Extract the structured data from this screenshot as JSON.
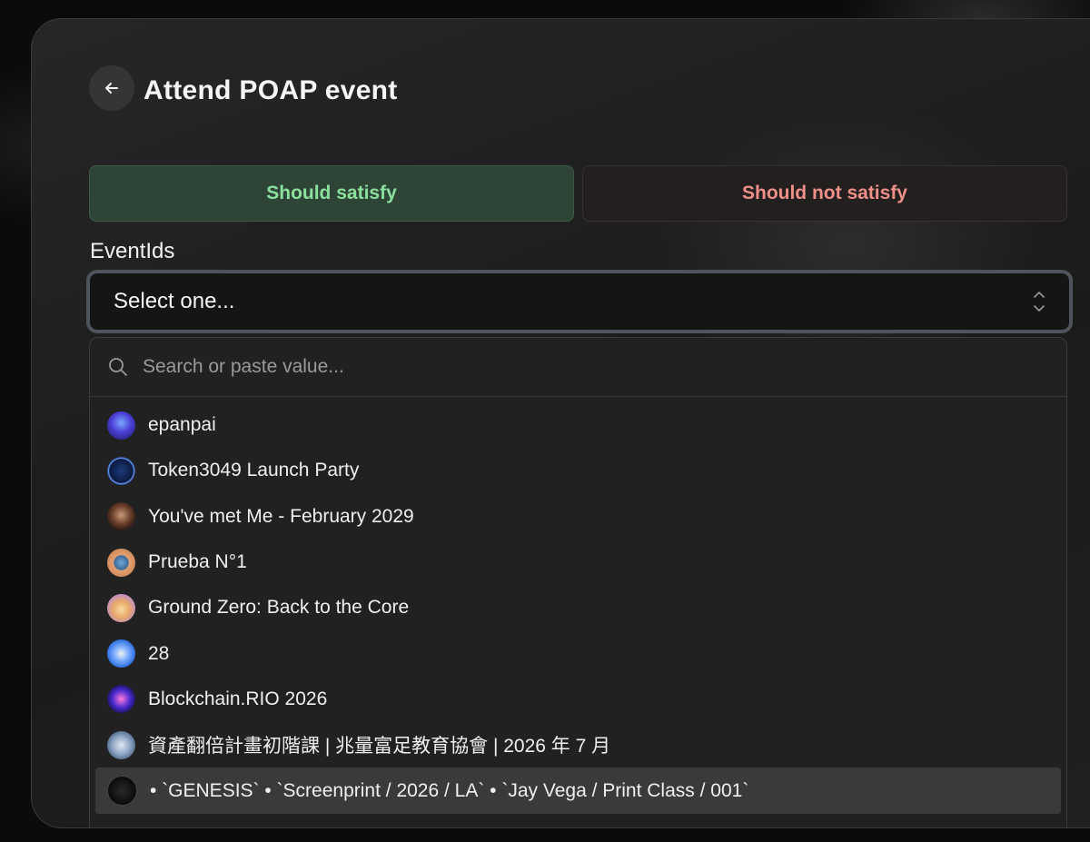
{
  "header": {
    "title": "Attend POAP event"
  },
  "toggles": {
    "should_satisfy": "Should satisfy",
    "should_not_satisfy": "Should not satisfy"
  },
  "field": {
    "label": "EventIds",
    "select_placeholder": "Select one..."
  },
  "search": {
    "placeholder": "Search or paste value..."
  },
  "options": [
    {
      "label": "epanpai",
      "icon": "event-avatar"
    },
    {
      "label": "Token3049 Launch Party",
      "icon": "event-avatar"
    },
    {
      "label": "You've met Me - February 2029",
      "icon": "event-avatar"
    },
    {
      "label": "Prueba N°1",
      "icon": "event-avatar"
    },
    {
      "label": "Ground Zero: Back to the Core",
      "icon": "event-avatar"
    },
    {
      "label": "28",
      "icon": "event-avatar"
    },
    {
      "label": "Blockchain.RIO 2026",
      "icon": "event-avatar"
    },
    {
      "label": "資產翻倍計畫初階課 | 兆量富足教育協會 | 2026 年 7 月",
      "icon": "event-avatar"
    },
    {
      "label": "• `GENESIS` • `Screenprint / 2026 / LA` • `Jay Vega / Print Class / 001`",
      "icon": "event-avatar"
    }
  ],
  "colors": {
    "satisfy_text": "#8be09e",
    "not_satisfy_text": "#ef8f8a",
    "highlight_row": "#3a3a3a"
  }
}
